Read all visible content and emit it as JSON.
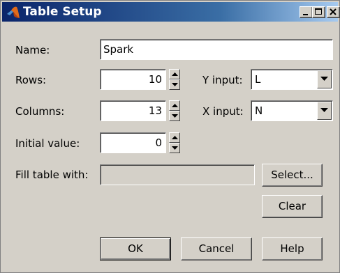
{
  "window": {
    "title": "Table Setup",
    "title_bar_gradient": [
      "#0a246a",
      "#a6caf0"
    ],
    "icon": "matlab-logo-icon"
  },
  "title_buttons": {
    "minimize_icon": "minimize-icon",
    "maximize_icon": "maximize-icon",
    "close_icon": "close-icon"
  },
  "form": {
    "name_label": "Name:",
    "name_value": "Spark",
    "rows_label": "Rows:",
    "rows_value": "10",
    "columns_label": "Columns:",
    "columns_value": "13",
    "initial_label": "Initial value:",
    "initial_value": "0",
    "fill_label": "Fill table with:",
    "fill_value": "",
    "y_input_label": "Y input:",
    "y_input_value": "L",
    "x_input_label": "X input:",
    "x_input_value": "N"
  },
  "buttons": {
    "select": "Select...",
    "clear": "Clear",
    "ok": "OK",
    "cancel": "Cancel",
    "help": "Help"
  }
}
